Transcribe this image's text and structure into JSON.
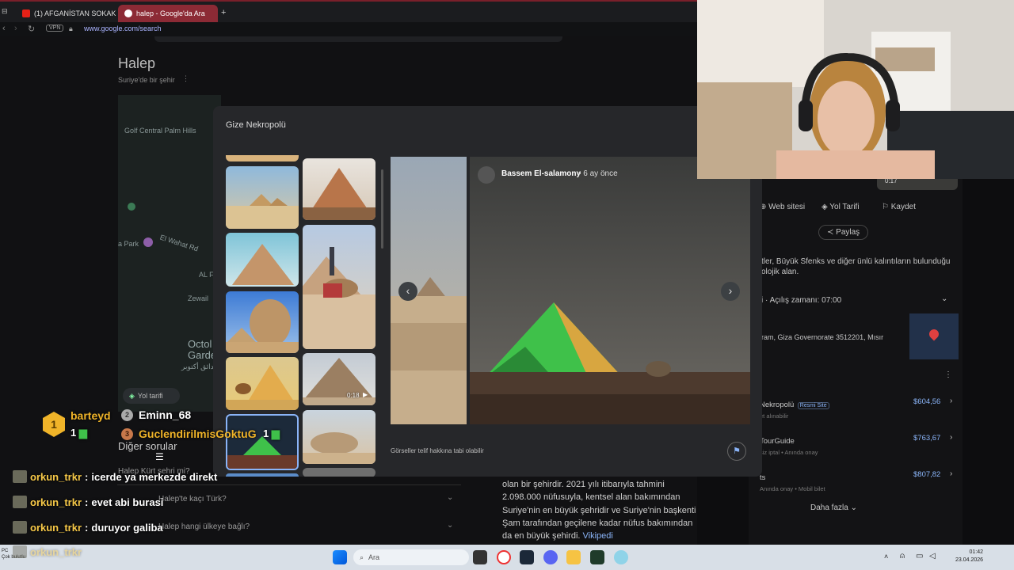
{
  "browser": {
    "tabs": [
      {
        "label": "(1) AFGANİSTAN SOKAK Y"
      },
      {
        "label": "halep - Google'da Ara"
      }
    ],
    "new_tab_glyph": "+",
    "vpn_label": "VPN",
    "url": "www.google.com/search"
  },
  "search": {
    "title": "Halep",
    "subtitle": "Suriye'de bir şehir",
    "map_labels": [
      "Golf Central Palm Hills",
      "El Wahat Rd",
      "a Park",
      "AL F",
      "Zewail",
      "Octol Garde",
      "حدائق أكتوبر",
      "Yol tarifi"
    ],
    "other_questions_label": "Diğer sorular",
    "questions": [
      "Halep Kürt şehri mi?",
      "Halep'te kaçı Türk?",
      "Halep hangi ülkeye bağlı?"
    ],
    "description": [
      "olan bir şehirdir. 2021 yılı itibarıyla tahmini",
      "2.098.000 nüfusuyla, kentsel alan bakımından",
      "Suriye'nin en büyük şehridir ve Suriye'nin başkenti",
      "Şam tarafından geçilene kadar nüfus bakımından",
      "da en büyük şehirdi."
    ],
    "wiki_link": "Vikipedi"
  },
  "modal": {
    "title": "Gize Nekropolü",
    "author": "Bassem El-salamony",
    "time": "6 ay önce",
    "copyright_note": "Görseller telif hakkına tabi olabilir",
    "video_duration": "0:18",
    "icons": {
      "prev": "chevron-left-icon",
      "next": "chevron-right-icon",
      "flag": "flag-icon",
      "play": "play-icon"
    }
  },
  "knowledge_panel": {
    "video_time": "0:17",
    "actions": [
      "Web sitesi",
      "Yol Tarifi",
      "Kaydet"
    ],
    "share": "Paylaş",
    "desc_lines": [
      "tler, Büyük Sfenks ve diğer ünlü kalıntıların bulunduğu",
      "olojik alan."
    ],
    "hours": "Açılış zamanı: 07:00",
    "address": "ram, Giza Governorate 3512201, Mısır",
    "tickets": [
      {
        "name": "Nekropolü",
        "badge": "Resmi Site",
        "sub": "et alınabilir",
        "price": "$604,56"
      },
      {
        "name": "TourGuide",
        "badge": "",
        "sub": "siz iptal • Anında onay",
        "price": "$763,67"
      },
      {
        "name": "ts",
        "badge": "",
        "sub": "Anında onay • Mobil bilet",
        "price": "$807,82"
      }
    ],
    "more": "Daha fazla"
  },
  "stream_overlay": {
    "top_users": [
      {
        "rank": "1",
        "name": "barteyd",
        "count": "1"
      },
      {
        "rank": "2",
        "name": "Eminn_68",
        "count": ""
      },
      {
        "rank": "3",
        "name": "GuclendirilmisGoktuG",
        "count": "1"
      }
    ],
    "chat": [
      {
        "user": "orkun_trkr",
        "msg": "icerde ya merkezde direkt"
      },
      {
        "user": "orkun_trkr",
        "msg": "evet abi burasi"
      },
      {
        "user": "orkun_trkr",
        "msg": "duruyor galiba"
      },
      {
        "user": "orkun_trkr",
        "msg": ""
      }
    ]
  },
  "taskbar": {
    "weather": "PC",
    "weather_sub": "Çok bulutlu",
    "search_placeholder": "Ara",
    "time": "01:42",
    "date": "23.04.2026"
  },
  "colors": {
    "accent_red": "#8c2a35",
    "price_blue": "#8ab4f8",
    "green_laser": "#3fc14a"
  }
}
